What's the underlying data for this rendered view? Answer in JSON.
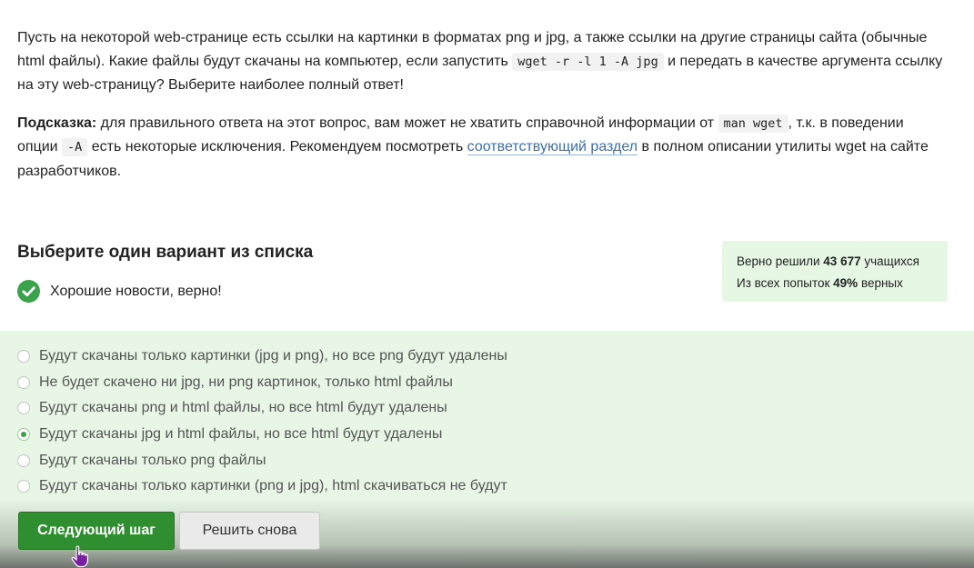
{
  "question": {
    "p1_before": "Пусть на некоторой web-странице есть ссылки на картинки в форматах png и jpg, а также ссылки на другие страницы сайта (обычные html файлы). Какие файлы будут скачаны на компьютер, если запустить ",
    "p1_code": "wget -r -l 1 -A jpg",
    "p1_after": " и передать в качестве аргумента ссылку на эту web-страницу? Выберите наиболее полный ответ!",
    "hint_label": "Подсказка:",
    "hint_part1": " для правильного ответа на этот вопрос, вам может не хватить справочной информации от ",
    "hint_code1": "man wget",
    "hint_part2": ", т.к. в поведении опции ",
    "hint_code2": "-A",
    "hint_part3": " есть некоторые исключения. Рекомендуем посмотреть ",
    "hint_link": "соответствующий раздел",
    "hint_part4": " в полном описании утилиты wget на сайте разработчиков."
  },
  "choose": {
    "title": "Выберите один вариант из списка",
    "status": "Хорошие новости, верно!"
  },
  "stats": {
    "solved_prefix": "Верно решили ",
    "solved_count": "43 677",
    "solved_suffix": " учащихся",
    "attempts_prefix": "Из всех попыток ",
    "attempts_percent": "49%",
    "attempts_suffix": " верных"
  },
  "options": [
    {
      "label": "Будут скачаны только картинки (jpg и png), но все png будут удалены",
      "selected": false
    },
    {
      "label": "Не будет скачено ни jpg, ни png картинок, только html файлы",
      "selected": false
    },
    {
      "label": "Будут скачаны png и html файлы, но все html будут удалены",
      "selected": false
    },
    {
      "label": "Будут скачаны jpg и html файлы, но все html будут удалены",
      "selected": true
    },
    {
      "label": "Будут скачаны только png файлы",
      "selected": false
    },
    {
      "label": "Будут скачаны только картинки (png и jpg), html скачиваться не будут",
      "selected": false
    }
  ],
  "buttons": {
    "next": "Следующий шаг",
    "retry": "Решить снова"
  },
  "colors": {
    "accent": "#2f8e2f",
    "success_bg": "#e7f6e5",
    "check": "#3aa24a",
    "link": "#3a6fb0"
  },
  "icons": {
    "status": "check-circle-icon",
    "cursor": "hand-pointer-icon"
  }
}
